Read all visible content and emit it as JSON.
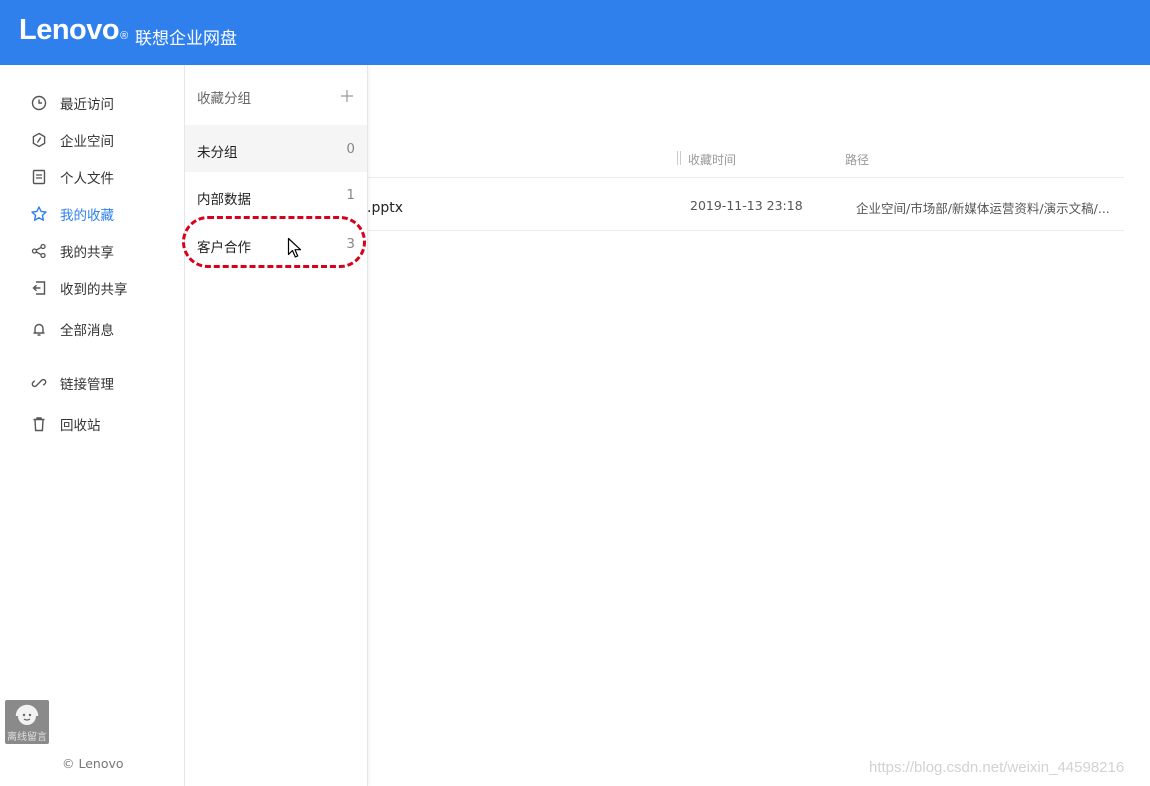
{
  "header": {
    "logo": "Lenovo",
    "logo_mark": "®",
    "product_name": "联想企业网盘",
    "background_color": "#2f80ed"
  },
  "sidebar": {
    "accent_color": "#2f80ed",
    "items": [
      {
        "label": "最近访问",
        "icon": "clock-icon",
        "active": false
      },
      {
        "label": "企业空间",
        "icon": "hexagon-icon",
        "active": false
      },
      {
        "label": "个人文件",
        "icon": "document-icon",
        "active": false
      },
      {
        "label": "我的收藏",
        "icon": "star-icon",
        "active": true
      },
      {
        "label": "我的共享",
        "icon": "share-icon",
        "active": false
      },
      {
        "label": "收到的共享",
        "icon": "received-share-icon",
        "active": false
      },
      {
        "label": "全部消息",
        "icon": "bell-icon",
        "active": false
      },
      {
        "label": "链接管理",
        "icon": "link-icon",
        "active": false
      },
      {
        "label": "回收站",
        "icon": "trash-icon",
        "active": false
      }
    ],
    "support_widget": {
      "label": "离线留言",
      "icon": "headset-avatar-icon"
    },
    "copyright": "© Lenovo"
  },
  "favorite_groups": {
    "title": "收藏分组",
    "add_icon": "plus-icon",
    "groups": [
      {
        "name": "未分组",
        "count": "0",
        "selected": true
      },
      {
        "name": "内部数据",
        "count": "1",
        "selected": false
      },
      {
        "name": "客户合作",
        "count": "3",
        "selected": false
      }
    ]
  },
  "file_table": {
    "columns": {
      "favorite_time": "收藏时间",
      "path": "路径"
    },
    "rows": [
      {
        "name_visible": "册.pptx",
        "favorite_time": "2019-11-13 23:18",
        "path": "企业空间/市场部/新媒体运营资料/演示文稿/..."
      }
    ]
  },
  "annotation": {
    "highlight_color": "#d8001b"
  },
  "watermark": "https://blog.csdn.net/weixin_44598216"
}
